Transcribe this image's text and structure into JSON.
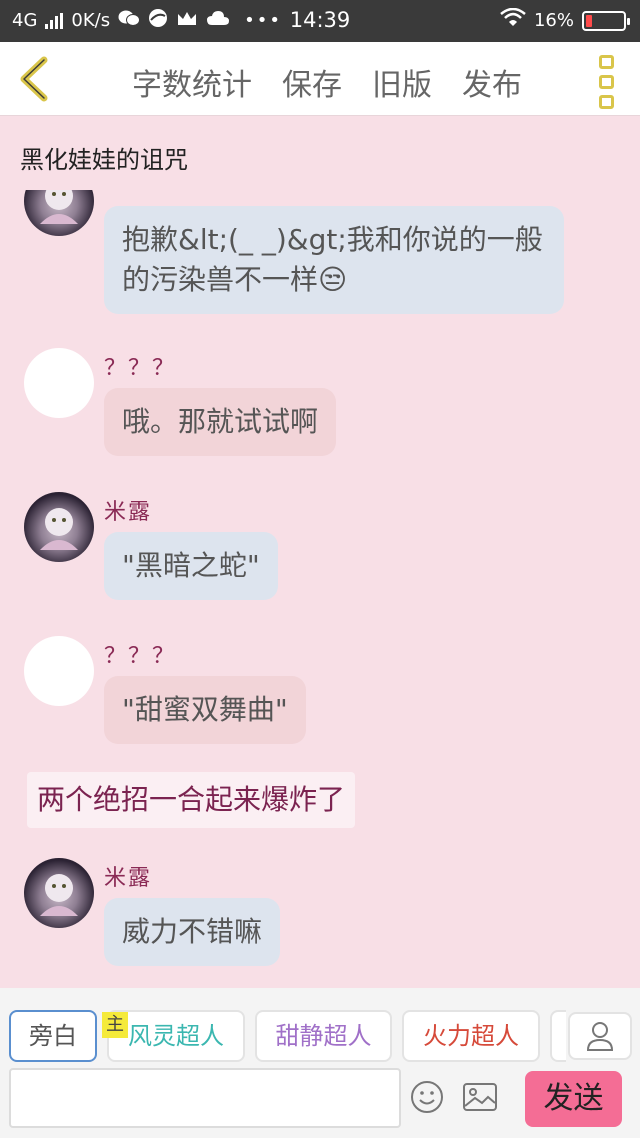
{
  "status": {
    "network": "4G",
    "speed": "0K/s",
    "time": "14:39",
    "battery": "16%",
    "battery_level": 0.16,
    "icons": [
      "signal-icon",
      "wechat-icon",
      "browser-icon",
      "crown-icon",
      "cloud-icon",
      "more-dots-icon",
      "wifi-icon",
      "battery-icon"
    ]
  },
  "nav": {
    "word_count": "字数统计",
    "save": "保存",
    "old_version": "旧版",
    "publish": "发布"
  },
  "story": {
    "title": "黑化娃娃的诅咒"
  },
  "messages": [
    {
      "type": "bubble",
      "avatar": "character",
      "name": "",
      "text": "抱歉&lt;(_ _)&gt;我和你说的一般的污染兽不一样😒",
      "color": "blue"
    },
    {
      "type": "bubble",
      "avatar": "blank",
      "name": "？？？",
      "text": "哦。那就试试啊",
      "color": "pink"
    },
    {
      "type": "bubble",
      "avatar": "character",
      "name": "米露",
      "text": "\"黑暗之蛇\"",
      "color": "blue"
    },
    {
      "type": "bubble",
      "avatar": "blank",
      "name": "？？？",
      "text": "\"甜蜜双舞曲\"",
      "color": "pink"
    },
    {
      "type": "narration",
      "text": "两个绝招一合起来爆炸了"
    },
    {
      "type": "bubble",
      "avatar": "character",
      "name": "米露",
      "text": "威力不错嘛",
      "color": "blue"
    }
  ],
  "roles": [
    {
      "label": "旁白",
      "color": "#555555"
    },
    {
      "label": "风灵超人",
      "color": "#3bb7b0"
    },
    {
      "label": "甜静超人",
      "color": "#a070c8"
    },
    {
      "label": "火力超人",
      "color": "#d64a3a"
    }
  ],
  "host_badge": "主",
  "send_label": "发送",
  "colors": {
    "background": "#f8dfe6",
    "accent": "#f46d95",
    "name": "#8a2a55"
  }
}
